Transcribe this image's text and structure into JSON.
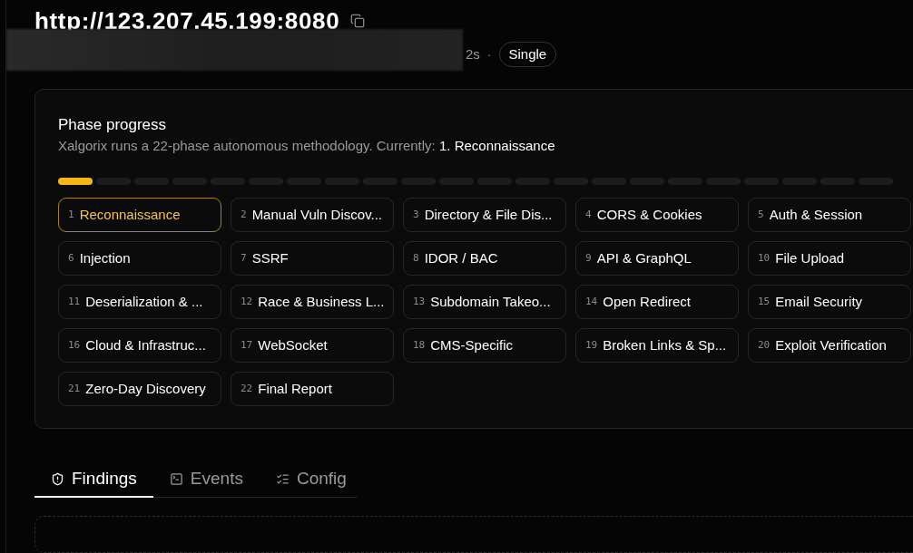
{
  "target": {
    "url": "http://123.207.45.199:8080",
    "meta": "2s",
    "separator": "·",
    "mode_badge": "Single"
  },
  "phase_progress": {
    "title": "Phase progress",
    "description": "Xalgorix runs a 22-phase autonomous methodology. Currently: ",
    "current": "1. Reconnaissance",
    "phases": [
      {
        "number": "1",
        "label": "Reconnaissance",
        "selected": true
      },
      {
        "number": "2",
        "label": "Manual Vuln Discov...",
        "selected": false
      },
      {
        "number": "3",
        "label": "Directory & File Dis...",
        "selected": false
      },
      {
        "number": "4",
        "label": "CORS & Cookies",
        "selected": false
      },
      {
        "number": "5",
        "label": "Auth & Session",
        "selected": false
      },
      {
        "number": "6",
        "label": "Injection",
        "selected": false
      },
      {
        "number": "7",
        "label": "SSRF",
        "selected": false
      },
      {
        "number": "8",
        "label": "IDOR / BAC",
        "selected": false
      },
      {
        "number": "9",
        "label": "API & GraphQL",
        "selected": false
      },
      {
        "number": "10",
        "label": "File Upload",
        "selected": false
      },
      {
        "number": "11",
        "label": "Deserialization & ...",
        "selected": false
      },
      {
        "number": "12",
        "label": "Race & Business L...",
        "selected": false
      },
      {
        "number": "13",
        "label": "Subdomain Takeo...",
        "selected": false
      },
      {
        "number": "14",
        "label": "Open Redirect",
        "selected": false
      },
      {
        "number": "15",
        "label": "Email Security",
        "selected": false
      },
      {
        "number": "16",
        "label": "Cloud & Infrastruc...",
        "selected": false
      },
      {
        "number": "17",
        "label": "WebSocket",
        "selected": false
      },
      {
        "number": "18",
        "label": "CMS-Specific",
        "selected": false
      },
      {
        "number": "19",
        "label": "Broken Links & Sp...",
        "selected": false
      },
      {
        "number": "20",
        "label": "Exploit Verification",
        "selected": false
      },
      {
        "number": "21",
        "label": "Zero-Day Discovery",
        "selected": false
      },
      {
        "number": "22",
        "label": "Final Report",
        "selected": false
      }
    ]
  },
  "tabs": [
    {
      "label": "Findings",
      "kind": "shield",
      "selected": true
    },
    {
      "label": "Events",
      "kind": "terminal",
      "selected": false
    },
    {
      "label": "Config",
      "kind": "checklist",
      "selected": false
    }
  ]
}
